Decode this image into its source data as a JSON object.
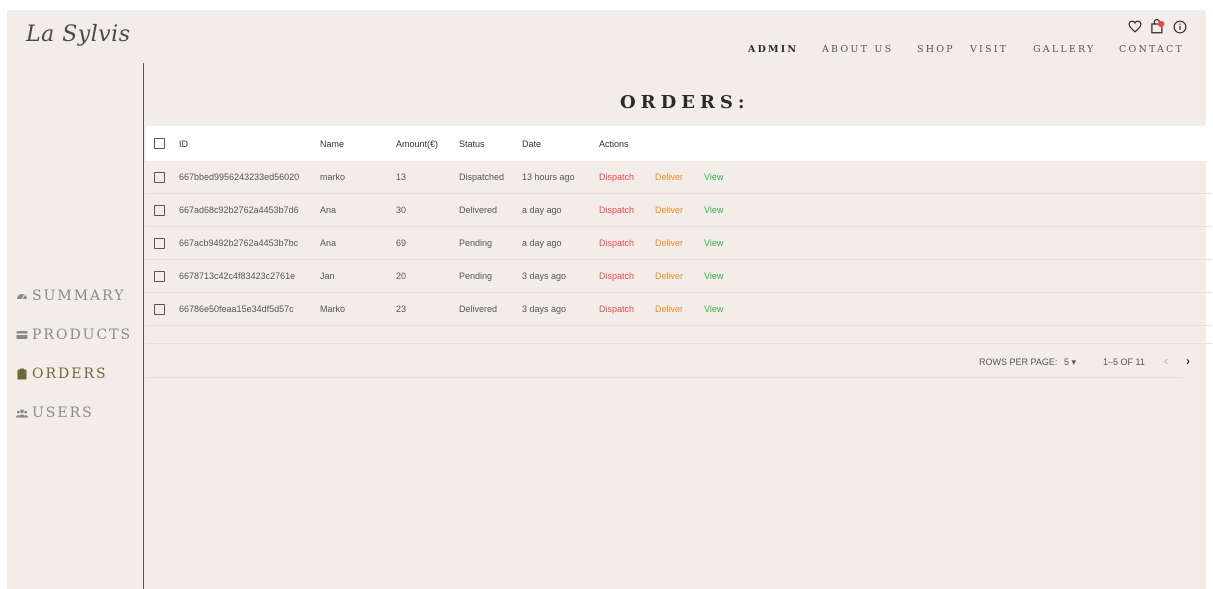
{
  "logo": "La Sylvis",
  "nav": [
    {
      "label": "ADMIN",
      "active": true
    },
    {
      "label": "ABOUT US"
    },
    {
      "label": "SHOP"
    },
    {
      "label": "VISIT"
    },
    {
      "label": "GALLERY"
    },
    {
      "label": "CONTACT"
    }
  ],
  "header_icons": [
    "heart-icon",
    "shopping-bag-icon",
    "info-icon"
  ],
  "sidebar": {
    "items": [
      {
        "label": "SUMMARY",
        "icon": "dashboard-icon"
      },
      {
        "label": "PRODUCTS",
        "icon": "card-icon"
      },
      {
        "label": "ORDERS",
        "icon": "clipboard-icon",
        "active": true
      },
      {
        "label": "USERS",
        "icon": "users-icon"
      }
    ]
  },
  "page_title": "ORDERS:",
  "table": {
    "headers": [
      "ID",
      "Name",
      "Amount(€)",
      "Status",
      "Date",
      "Actions"
    ],
    "actions": [
      "Dispatch",
      "Deliver",
      "View"
    ],
    "rows": [
      {
        "id": "667bbed9956243233ed56020",
        "name": "marko",
        "amount": "13",
        "status": "Dispatched",
        "date": "13 hours ago"
      },
      {
        "id": "667ad68c92b2762a4453b7d6",
        "name": "Ana",
        "amount": "30",
        "status": "Delivered",
        "date": "a day ago"
      },
      {
        "id": "667acb9492b2762a4453b7bc",
        "name": "Ana",
        "amount": "69",
        "status": "Pending",
        "date": "a day ago"
      },
      {
        "id": "6678713c42c4f83423c2761e",
        "name": "Jan",
        "amount": "20",
        "status": "Pending",
        "date": "3 days ago"
      },
      {
        "id": "66786e50feaa15e34df5d57c",
        "name": "Marko",
        "amount": "23",
        "status": "Delivered",
        "date": "3 days ago"
      }
    ]
  },
  "pagination": {
    "rows_per_page_label": "ROWS PER PAGE:",
    "rows_per_page": "5",
    "range": "1–5 OF 11"
  },
  "colors": {
    "background": "#f3ede9",
    "dispatch": "#e54b4b",
    "deliver": "#f08a24",
    "view": "#34b24a",
    "active_sidebar": "#6b6b3a"
  }
}
